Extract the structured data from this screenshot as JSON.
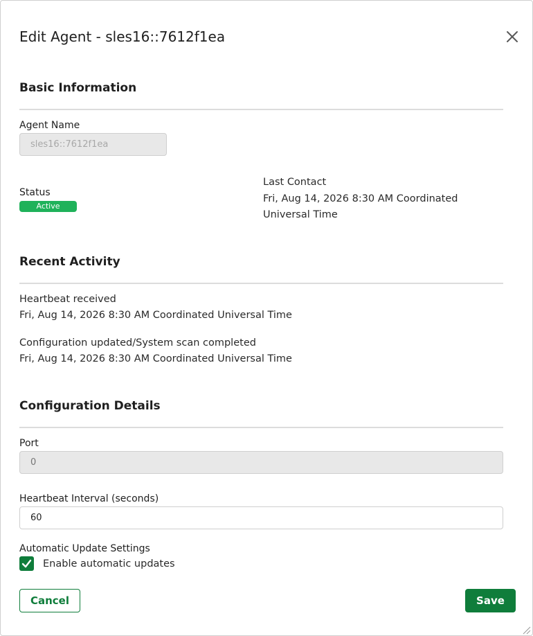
{
  "dialog": {
    "title": "Edit Agent - sles16::7612f1ea"
  },
  "basic": {
    "heading": "Basic Information",
    "agent_name_label": "Agent Name",
    "agent_name_value": "sles16::7612f1ea",
    "status_label": "Status",
    "status_value": "Active",
    "last_contact_label": "Last Contact",
    "last_contact_line1": "Fri, Aug 14, 2026 8:30 AM Coordinated",
    "last_contact_line2": "Universal Time"
  },
  "activity": {
    "heading": "Recent Activity",
    "items": [
      {
        "event": "Heartbeat received",
        "time": "Fri, Aug 14, 2026 8:30 AM Coordinated Universal Time"
      },
      {
        "event": "Configuration updated/System scan completed",
        "time": "Fri, Aug 14, 2026 8:30 AM Coordinated Universal Time"
      }
    ]
  },
  "config": {
    "heading": "Configuration Details",
    "port_label": "Port",
    "port_placeholder": "0",
    "heartbeat_label": "Heartbeat Interval (seconds)",
    "heartbeat_value": "60",
    "auto_update_label": "Automatic Update Settings",
    "auto_update_checkbox_label": "Enable automatic updates",
    "auto_update_enabled": true
  },
  "buttons": {
    "cancel": "Cancel",
    "save": "Save"
  },
  "colors": {
    "primary": "#0f7d3b",
    "status_active": "#1fb25a",
    "divider": "#dcdcdc",
    "disabled_field": "#e8e8e8"
  },
  "icons": {
    "close": "close-icon",
    "check": "checkmark-icon",
    "resize": "resize-grip-icon"
  }
}
